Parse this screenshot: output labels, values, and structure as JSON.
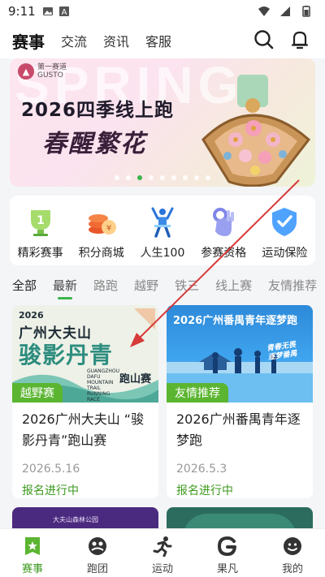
{
  "status_bar": {
    "time": "9:11"
  },
  "header": {
    "tabs": [
      {
        "label": "赛事",
        "active": true
      },
      {
        "label": "交流",
        "active": false
      },
      {
        "label": "资讯",
        "active": false
      },
      {
        "label": "客服",
        "active": false
      }
    ],
    "icons": [
      "search-icon",
      "bell-icon"
    ]
  },
  "banner": {
    "bg_text": "SPRING",
    "logo_cn": "第一赛道",
    "logo_en": "GUSTO",
    "title": "2026四季线上跑",
    "subtitle": "春醒繁花",
    "slide_count": 9,
    "active_slide": 2
  },
  "quick_menu": [
    {
      "label": "精彩赛事",
      "icon": "trophy-icon"
    },
    {
      "label": "积分商城",
      "icon": "coins-icon"
    },
    {
      "label": "人生100",
      "icon": "runner-figure-icon"
    },
    {
      "label": "参赛资格",
      "icon": "ok-hand-icon"
    },
    {
      "label": "运动保险",
      "icon": "shield-check-icon"
    }
  ],
  "categories": [
    {
      "label": "全部",
      "state": "active"
    },
    {
      "label": "最新",
      "state": "selected"
    },
    {
      "label": "路跑",
      "state": "normal"
    },
    {
      "label": "越野",
      "state": "normal"
    },
    {
      "label": "铁三",
      "state": "normal"
    },
    {
      "label": "线上赛",
      "state": "normal"
    },
    {
      "label": "友情推荐",
      "state": "normal"
    }
  ],
  "events": [
    {
      "tag": "越野赛",
      "title": "2026广州大夫山 “骏影丹青”跑山赛",
      "date": "2026.5.16",
      "status": "报名进行中",
      "poster": {
        "year": "2026",
        "name": "广州大夫山",
        "slogan": "骏影丹青",
        "en": "GUANGZHOU DAFU MOUNTAIN TRAIL RUNNING RACE",
        "type": "跑山赛"
      }
    },
    {
      "tag": "友情推荐",
      "title": "2026广州番禺青年逐梦跑",
      "date": "2026.5.3",
      "status": "报名进行中",
      "poster": {
        "heading": "2026广州番禺青年逐梦跑",
        "slogan": "青春无畏 逐梦番禺"
      }
    },
    {
      "poster": {
        "label": "大夫山森林公园"
      }
    },
    {
      "poster": {}
    }
  ],
  "bottom_nav": [
    {
      "label": "赛事",
      "icon": "event-badge-icon",
      "active": true
    },
    {
      "label": "跑团",
      "icon": "team-icon",
      "active": false
    },
    {
      "label": "运动",
      "icon": "running-icon",
      "active": false
    },
    {
      "label": "果凡",
      "icon": "guofan-g-icon",
      "active": false
    },
    {
      "label": "我的",
      "icon": "profile-icon",
      "active": false
    }
  ],
  "colors": {
    "accent_green": "#3cb44b",
    "status_green": "#3e9a1f",
    "tag_green": "#5bb531",
    "arrow_red": "#d63a3a"
  }
}
